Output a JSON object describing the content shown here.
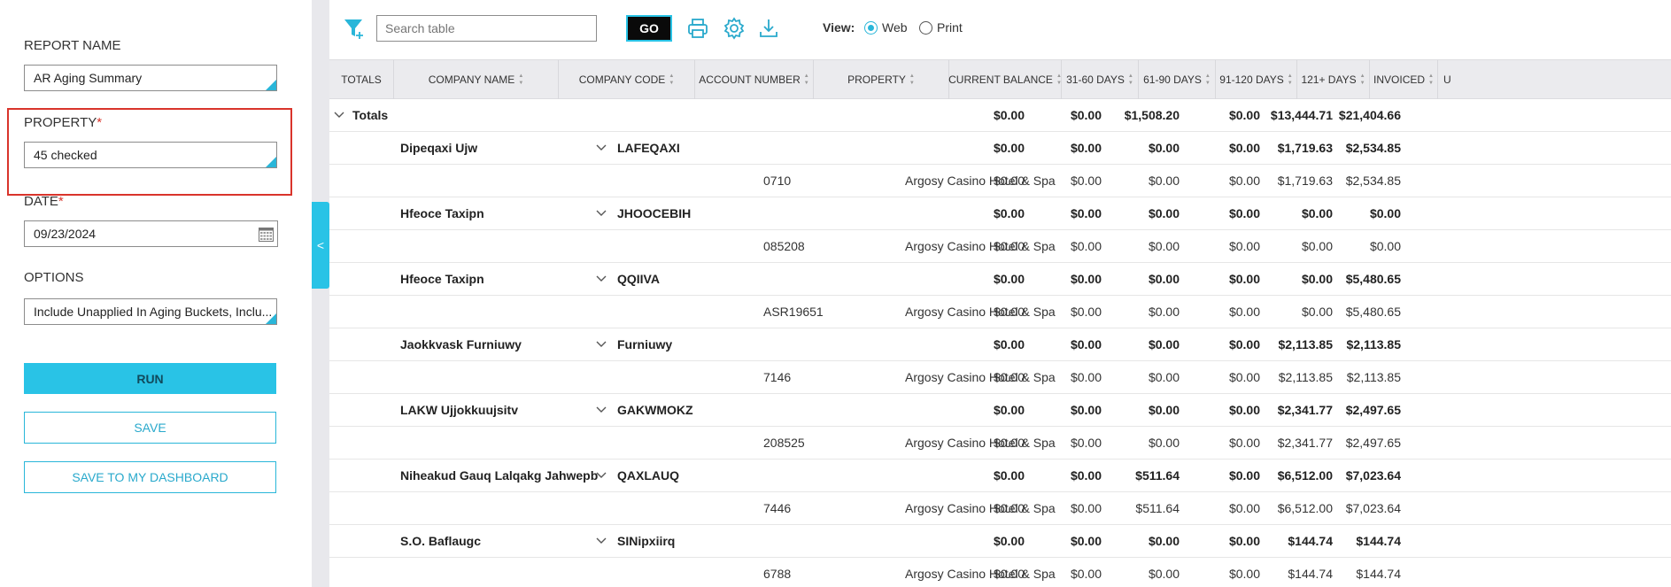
{
  "sidebar": {
    "report_name_label": "REPORT NAME",
    "report_name_value": "AR Aging Summary",
    "property_label": "PROPERTY",
    "property_required": "*",
    "property_value": "45 checked",
    "date_label": "DATE",
    "date_required": "*",
    "date_value": "09/23/2024",
    "options_label": "OPTIONS",
    "options_value": "Include Unapplied In Aging Buckets, Inclu...",
    "run_label": "RUN",
    "save_label": "SAVE",
    "save_dashboard_label": "SAVE TO MY DASHBOARD"
  },
  "collapse_glyph": "<",
  "toolbar": {
    "search_placeholder": "Search table",
    "go_label": "GO",
    "view_label": "View:",
    "view_options": [
      "Web",
      "Print"
    ],
    "view_selected": "Web",
    "icons": [
      "filter-add-icon",
      "print-icon",
      "gear-icon",
      "download-icon"
    ]
  },
  "colors": {
    "accent": "#29c3e6",
    "highlight": "#d9342b"
  },
  "table": {
    "columns": [
      "TOTALS",
      "COMPANY NAME",
      "COMPANY CODE",
      "ACCOUNT NUMBER",
      "PROPERTY",
      "CURRENT BALANCE",
      "31-60 DAYS",
      "61-90 DAYS",
      "91-120 DAYS",
      "121+ DAYS",
      "INVOICED",
      "U"
    ],
    "totals_label": "Totals",
    "totals_row": [
      "$0.00",
      "$0.00",
      "$1,508.20",
      "$0.00",
      "$13,444.71",
      "$21,404.66"
    ],
    "rows": [
      {
        "type": "company",
        "name": "Dipeqaxi Ujw",
        "code": "LAFEQAXI",
        "values": [
          "$0.00",
          "$0.00",
          "$0.00",
          "$0.00",
          "$1,719.63",
          "$2,534.85"
        ]
      },
      {
        "type": "detail",
        "account": "0710",
        "property": "Argosy Casino Hotel & Spa",
        "values": [
          "$0.00",
          "$0.00",
          "$0.00",
          "$0.00",
          "$1,719.63",
          "$2,534.85"
        ]
      },
      {
        "type": "company",
        "name": "Hfeoce Taxipn",
        "code": "JHOOCEBIH",
        "values": [
          "$0.00",
          "$0.00",
          "$0.00",
          "$0.00",
          "$0.00",
          "$0.00"
        ]
      },
      {
        "type": "detail",
        "account": "085208",
        "property": "Argosy Casino Hotel & Spa",
        "values": [
          "$0.00",
          "$0.00",
          "$0.00",
          "$0.00",
          "$0.00",
          "$0.00"
        ]
      },
      {
        "type": "company",
        "name": "Hfeoce Taxipn",
        "code": "QQIIVA",
        "values": [
          "$0.00",
          "$0.00",
          "$0.00",
          "$0.00",
          "$0.00",
          "$5,480.65"
        ]
      },
      {
        "type": "detail",
        "account": "ASR19651",
        "property": "Argosy Casino Hotel & Spa",
        "values": [
          "$0.00",
          "$0.00",
          "$0.00",
          "$0.00",
          "$0.00",
          "$5,480.65"
        ]
      },
      {
        "type": "company",
        "name": "Jaokkvask Furniuwy",
        "code": "Furniuwy",
        "values": [
          "$0.00",
          "$0.00",
          "$0.00",
          "$0.00",
          "$2,113.85",
          "$2,113.85"
        ]
      },
      {
        "type": "detail",
        "account": "7146",
        "property": "Argosy Casino Hotel & Spa",
        "values": [
          "$0.00",
          "$0.00",
          "$0.00",
          "$0.00",
          "$2,113.85",
          "$2,113.85"
        ]
      },
      {
        "type": "company",
        "name": "LAKW Ujjokkuujsitv",
        "code": "GAKWMOKZ",
        "values": [
          "$0.00",
          "$0.00",
          "$0.00",
          "$0.00",
          "$2,341.77",
          "$2,497.65"
        ]
      },
      {
        "type": "detail",
        "account": "208525",
        "property": "Argosy Casino Hotel & Spa",
        "values": [
          "$0.00",
          "$0.00",
          "$0.00",
          "$0.00",
          "$2,341.77",
          "$2,497.65"
        ]
      },
      {
        "type": "company",
        "name": "Niheakud Gauq Lalqakg Jahwepb",
        "code": "QAXLAUQ",
        "values": [
          "$0.00",
          "$0.00",
          "$511.64",
          "$0.00",
          "$6,512.00",
          "$7,023.64"
        ]
      },
      {
        "type": "detail",
        "account": "7446",
        "property": "Argosy Casino Hotel & Spa",
        "values": [
          "$0.00",
          "$0.00",
          "$511.64",
          "$0.00",
          "$6,512.00",
          "$7,023.64"
        ]
      },
      {
        "type": "company",
        "name": "S.O. Baflaugc",
        "code": "SINipxiirq",
        "values": [
          "$0.00",
          "$0.00",
          "$0.00",
          "$0.00",
          "$144.74",
          "$144.74"
        ]
      },
      {
        "type": "detail",
        "account": "6788",
        "property": "Argosy Casino Hotel & Spa",
        "values": [
          "$0.00",
          "$0.00",
          "$0.00",
          "$0.00",
          "$144.74",
          "$144.74"
        ]
      }
    ]
  }
}
